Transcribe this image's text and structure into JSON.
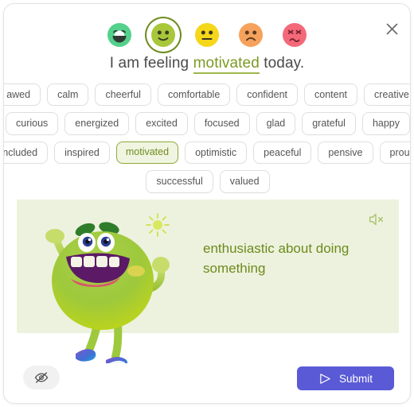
{
  "dialog": {
    "close_label": "×",
    "close_icon": "close-icon"
  },
  "mood_scale": {
    "icon_name": "emoji-face-icon",
    "selected_index": 1,
    "options": [
      {
        "label": "very happy",
        "face": "grin",
        "bg": "#54d18c",
        "selected": false
      },
      {
        "label": "happy",
        "face": "smile",
        "bg": "#a8c73a",
        "selected": true
      },
      {
        "label": "neutral",
        "face": "neutral",
        "bg": "#f5d71a",
        "selected": false
      },
      {
        "label": "sad",
        "face": "frown",
        "bg": "#f6a25c",
        "selected": false
      },
      {
        "label": "upset",
        "face": "confounded",
        "bg": "#f4697a",
        "selected": false
      }
    ]
  },
  "statement": {
    "prefix": "I am feeling ",
    "word": "motivated",
    "suffix": " today."
  },
  "word_chips": {
    "selected": "motivated",
    "rows": [
      [
        "awed",
        "calm",
        "cheerful",
        "comfortable",
        "confident",
        "content",
        "creative"
      ],
      [
        "curious",
        "energized",
        "excited",
        "focused",
        "glad",
        "grateful",
        "happy"
      ],
      [
        "included",
        "inspired",
        "motivated",
        "optimistic",
        "peaceful",
        "pensive",
        "proud"
      ],
      [
        "successful",
        "valued"
      ]
    ]
  },
  "definition_card": {
    "text": "enthusiastic about doing something",
    "mute_icon": "speaker-mute-icon",
    "background": "#edf2de",
    "text_color": "#6d8a1c",
    "illustration": "green-monster-character"
  },
  "footer": {
    "hide_icon": "eye-off-icon",
    "submit_label": "Submit",
    "submit_icon": "send-icon",
    "submit_color": "#5a5ad6"
  }
}
